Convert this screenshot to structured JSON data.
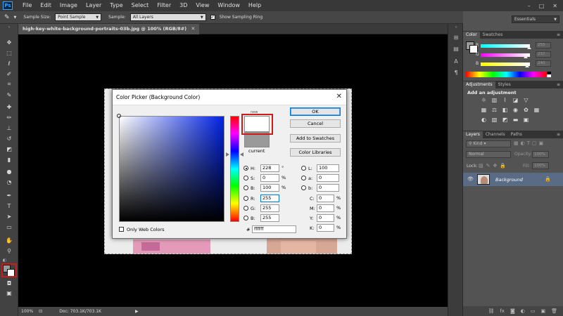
{
  "app": {
    "logo": "Ps",
    "menu": [
      "File",
      "Edit",
      "Image",
      "Layer",
      "Type",
      "Select",
      "Filter",
      "3D",
      "View",
      "Window",
      "Help"
    ],
    "window_controls": [
      "–",
      "□",
      "✕"
    ]
  },
  "options_bar": {
    "sample_size_label": "Sample Size:",
    "sample_size_value": "Point Sample",
    "sample_label": "Sample:",
    "sample_value": "All Layers",
    "show_ring_label": "Show Sampling Ring",
    "show_ring_checked": true
  },
  "workspace": {
    "value": "Essentials"
  },
  "document": {
    "tab_title": "high-key-white-background-portraits-03b.jpg @ 100% (RGB/8#)",
    "zoom": "100%",
    "doc_info": "Doc: 703.1K/703.1K"
  },
  "color_panel": {
    "tabs": [
      "Color",
      "Swatches"
    ],
    "sliders": [
      {
        "label": "R",
        "value": "255",
        "level": 0.99,
        "gradient": "linear-gradient(to right,#00ffff,#ffffff)"
      },
      {
        "label": "G",
        "value": "237",
        "level": 0.91,
        "gradient": "linear-gradient(to right,#ff00ff,#ffffff)"
      },
      {
        "label": "B",
        "value": "240",
        "level": 0.94,
        "gradient": "linear-gradient(to right,#ffff00,#ffffff)"
      }
    ]
  },
  "adjustments_panel": {
    "tabs": [
      "Adjustments",
      "Styles"
    ],
    "heading": "Add an adjustment"
  },
  "layers_panel": {
    "tabs": [
      "Layers",
      "Channels",
      "Paths"
    ],
    "kind_label": "Kind",
    "blend_mode": "Normal",
    "opacity_label": "Opacity:",
    "opacity_value": "100%",
    "lock_label": "Lock:",
    "fill_label": "Fill:",
    "fill_value": "100%",
    "layer_name": "Background"
  },
  "color_picker": {
    "title": "Color Picker (Background Color)",
    "new_label": "new",
    "current_label": "current",
    "new_color": "#ffffff",
    "current_color": "#9a9a9a",
    "buttons": {
      "ok": "OK",
      "cancel": "Cancel",
      "add_to_swatches": "Add to Swatches",
      "color_libraries": "Color Libraries"
    },
    "only_web_colors": "Only Web Colors",
    "hsb": [
      {
        "label": "H:",
        "value": "228",
        "unit": "°",
        "selected": true
      },
      {
        "label": "S:",
        "value": "0",
        "unit": "%",
        "selected": false
      },
      {
        "label": "B:",
        "value": "100",
        "unit": "%",
        "selected": false
      }
    ],
    "rgb": [
      {
        "label": "R:",
        "value": "255"
      },
      {
        "label": "G:",
        "value": "255"
      },
      {
        "label": "B:",
        "value": "255"
      }
    ],
    "lab": [
      {
        "label": "L:",
        "value": "100"
      },
      {
        "label": "a:",
        "value": "0"
      },
      {
        "label": "b:",
        "value": "0"
      }
    ],
    "cmyk": [
      {
        "label": "C:",
        "value": "0",
        "unit": "%"
      },
      {
        "label": "M:",
        "value": "0",
        "unit": "%"
      },
      {
        "label": "Y:",
        "value": "0",
        "unit": "%"
      },
      {
        "label": "K:",
        "value": "0",
        "unit": "%"
      }
    ],
    "hex_label": "#",
    "hex_value": "ffffff"
  },
  "colors": {
    "highlight": "#d01a1a",
    "foreground_swatch": "#9a9a9a",
    "background_swatch": "#ffffff"
  }
}
